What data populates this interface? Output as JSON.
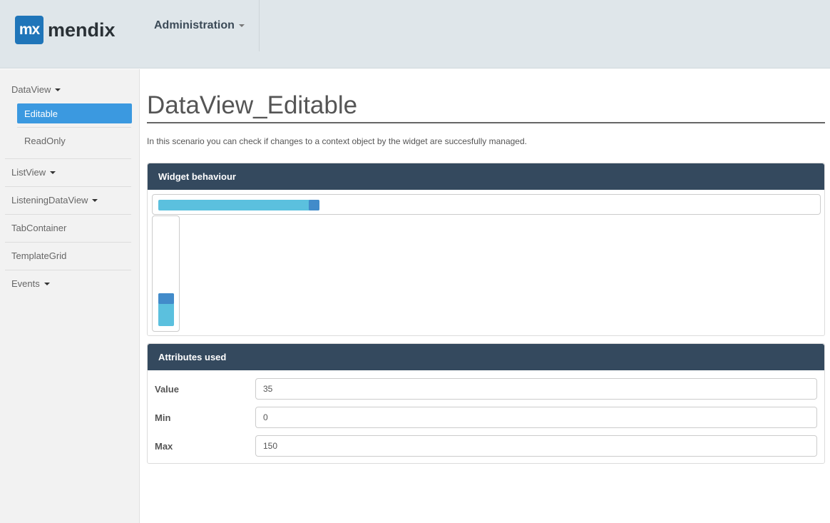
{
  "header": {
    "logo_mark": "mx",
    "logo_text": "mendix",
    "admin_menu": "Administration"
  },
  "sidebar": {
    "items": [
      {
        "label": "DataView",
        "dropdown": true
      },
      {
        "label": "Editable",
        "active": true,
        "sub": true
      },
      {
        "label": "ReadOnly",
        "sub": true
      },
      {
        "label": "ListView",
        "dropdown": true
      },
      {
        "label": "ListeningDataView",
        "dropdown": true
      },
      {
        "label": "TabContainer"
      },
      {
        "label": "TemplateGrid"
      },
      {
        "label": "Events",
        "dropdown": true
      }
    ]
  },
  "main": {
    "title": "DataView_Editable",
    "intro": "In this scenario you can check if changes to a context object by the widget are succesfully managed.",
    "widget_panel": {
      "title": "Widget behaviour",
      "slider_value": 35,
      "slider_min": 0,
      "slider_max": 150
    },
    "attributes_panel": {
      "title": "Attributes used",
      "rows": [
        {
          "label": "Value",
          "value": "35"
        },
        {
          "label": "Min",
          "value": "0"
        },
        {
          "label": "Max",
          "value": "150"
        }
      ]
    }
  },
  "colors": {
    "header_bg": "#dfe6ea",
    "panel_head": "#34495e",
    "active_nav": "#3b99e0",
    "slider_track": "#5bc0de",
    "slider_handle": "#428bca",
    "logo": "#1f75b9"
  }
}
